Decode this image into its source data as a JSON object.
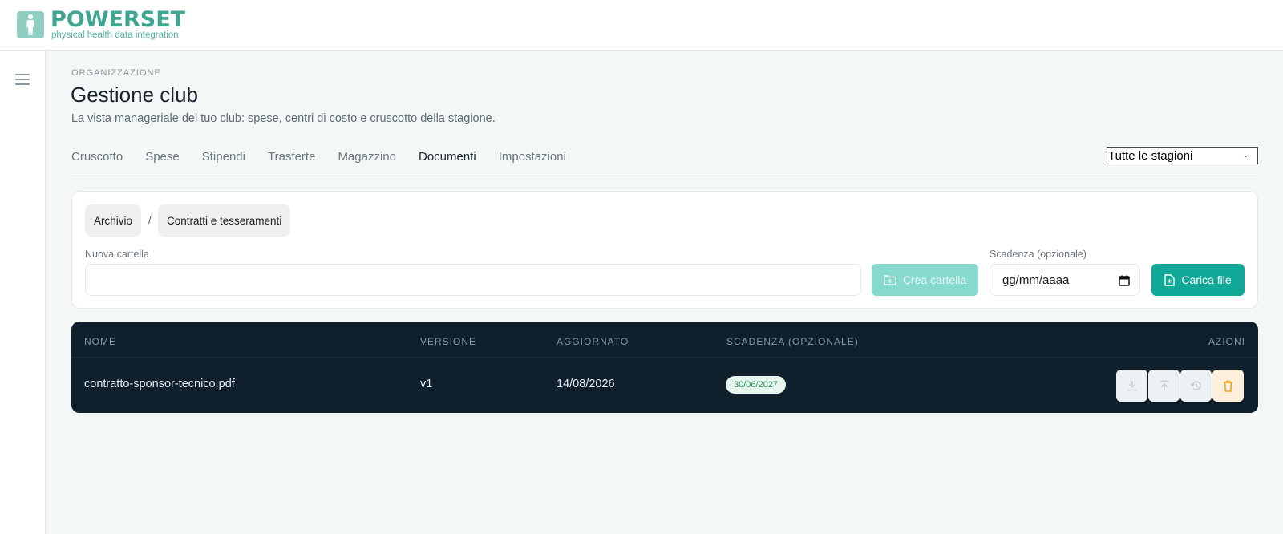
{
  "brand": {
    "name": "POWERSET",
    "tagline": "physical health data integration"
  },
  "sidebar": {
    "menu_icon": "hamburger-menu-icon"
  },
  "header": {
    "eyebrow": "ORGANIZZAZIONE",
    "title": "Gestione club",
    "description": "La vista manageriale del tuo club: spese, centri di costo e cruscotto della stagione."
  },
  "tabs": [
    {
      "label": "Cruscotto"
    },
    {
      "label": "Spese"
    },
    {
      "label": "Stipendi"
    },
    {
      "label": "Trasferte"
    },
    {
      "label": "Magazzino"
    },
    {
      "label": "Documenti",
      "active": true
    },
    {
      "label": "Impostazioni"
    }
  ],
  "season_filter": {
    "selected": "Tutte le stagioni"
  },
  "documents": {
    "breadcrumb": [
      "Archivio",
      "Contratti e tesseramenti"
    ],
    "breadcrumb_separator": "/",
    "new_folder_label": "Nuova cartella",
    "new_folder_value": "",
    "create_folder_button": "Crea cartella",
    "deadline_label": "Scadenza (opzionale)",
    "deadline_placeholder": "gg/mm/aaaa",
    "upload_button": "Carica file"
  },
  "table": {
    "columns": [
      "NOME",
      "VERSIONE",
      "AGGIORNATO",
      "SCADENZA (OPZIONALE)",
      "AZIONI"
    ],
    "rows": [
      {
        "name": "contratto-sponsor-tecnico.pdf",
        "version": "v1",
        "updated": "14/08/2026",
        "deadline": "30/06/2027",
        "actions": [
          "download-icon",
          "upload-new-version-icon",
          "history-icon",
          "trash-icon"
        ]
      }
    ]
  },
  "colors": {
    "brand": "#3ea691",
    "primary_button": "#12a898",
    "disabled_button": "#86d9cd",
    "table_bg": "#0f1f2c",
    "badge_bg": "#e7f6ef",
    "badge_text": "#2f8f5b",
    "delete_accent": "#f0a020"
  }
}
